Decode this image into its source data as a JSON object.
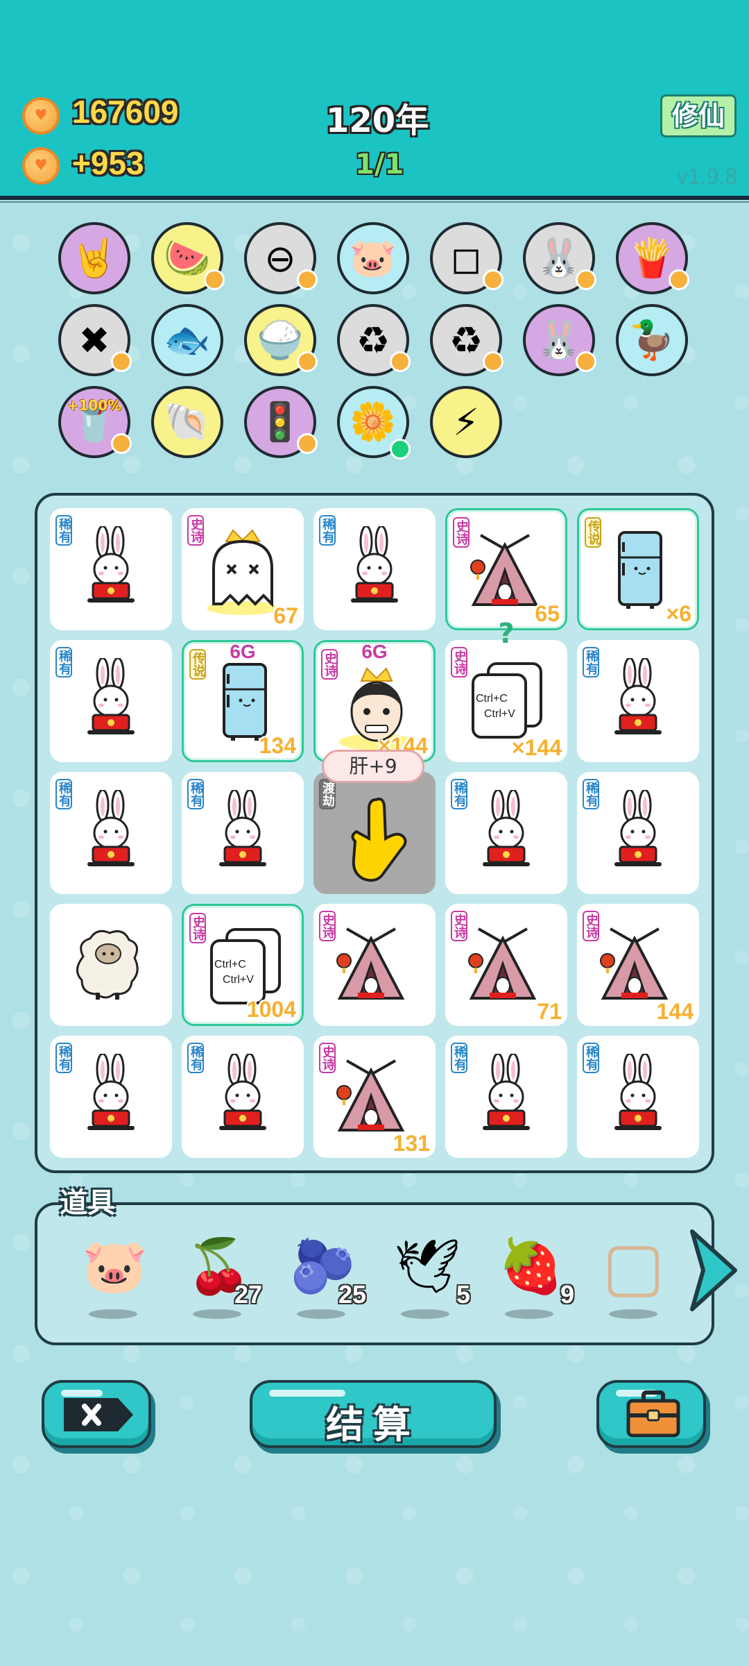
{
  "header": {
    "coins": "167609",
    "income": "+953",
    "year": "120年",
    "round": "1/1",
    "mode_button": "修仙",
    "version": "v1.9.8"
  },
  "relics": [
    {
      "icon": "rock-hand-icon",
      "bg": "#d6a8e3"
    },
    {
      "icon": "fruit-basket-icon",
      "bg": "#f7f28a",
      "badge": "V"
    },
    {
      "icon": "remove-circle-icon",
      "bg": "#dcdcdc"
    },
    {
      "icon": "piggy-bank-icon",
      "bg": "#b6ecf4"
    },
    {
      "icon": "white-cubes-icon",
      "bg": "#dcdcdc"
    },
    {
      "icon": "bunny-icon",
      "bg": "#dcdcdc"
    },
    {
      "icon": "french-fries-icon",
      "bg": "#d6a8e3"
    },
    {
      "icon": "delete-tag-icon",
      "bg": "#dcdcdc"
    },
    {
      "icon": "fish-bowl-icon",
      "bg": "#b6ecf4"
    },
    {
      "icon": "rice-bowl-icon",
      "bg": "#f7f28a"
    },
    {
      "icon": "refresh-green-icon",
      "bg": "#dcdcdc"
    },
    {
      "icon": "refresh-green-icon-2",
      "bg": "#dcdcdc"
    },
    {
      "icon": "bunny-pink-icon",
      "bg": "#d6a8e3"
    },
    {
      "icon": "duck-pot-icon",
      "bg": "#b6ecf4"
    },
    {
      "icon": "milk-tea-icon",
      "bg": "#d6a8e3",
      "label": "+100%"
    },
    {
      "icon": "shell-icon",
      "bg": "#f7f28a"
    },
    {
      "icon": "traffic-light-ghost-icon",
      "bg": "#d6a8e3"
    },
    {
      "icon": "flower-pot-icon",
      "bg": "#b6ecf4"
    },
    {
      "icon": "lightning-icon",
      "bg": "#f7f28a"
    }
  ],
  "tags": {
    "rare": "稀有",
    "epic": "史诗",
    "legend": "传说",
    "dujie": "渡劫"
  },
  "board": [
    [
      {
        "item": "bunny",
        "tag": "rare"
      },
      {
        "item": "ghost-crown",
        "tag": "epic",
        "count": "67"
      },
      {
        "item": "bunny",
        "tag": "rare"
      },
      {
        "item": "tent",
        "tag": "epic",
        "count": "65",
        "highlight": true
      },
      {
        "item": "fridge",
        "tag": "legend",
        "count": "×6",
        "highlight": true
      }
    ],
    [
      {
        "item": "bunny",
        "tag": "rare"
      },
      {
        "item": "fridge",
        "tag": "legend",
        "count": "134",
        "top": "6G",
        "highlight": true
      },
      {
        "item": "face-crown",
        "tag": "epic",
        "count": "×144",
        "top": "6G",
        "highlight": true
      },
      {
        "item": "copy-paste",
        "tag": "epic",
        "count": "×144",
        "question": "?"
      },
      {
        "item": "bunny",
        "tag": "rare"
      }
    ],
    [
      {
        "item": "bunny",
        "tag": "rare"
      },
      {
        "item": "bunny",
        "tag": "rare"
      },
      {
        "item": "hand-pointer",
        "tag": "dujie",
        "gray": true
      },
      {
        "item": "bunny",
        "tag": "rare"
      },
      {
        "item": "bunny",
        "tag": "rare"
      }
    ],
    [
      {
        "item": "sheep"
      },
      {
        "item": "copy-paste",
        "tag": "epic",
        "count": "1004",
        "highlight": true
      },
      {
        "item": "tent",
        "tag": "epic"
      },
      {
        "item": "tent",
        "tag": "epic",
        "count": "71"
      },
      {
        "item": "tent",
        "tag": "epic",
        "count": "144"
      }
    ],
    [
      {
        "item": "bunny",
        "tag": "rare"
      },
      {
        "item": "bunny",
        "tag": "rare"
      },
      {
        "item": "tent",
        "tag": "epic",
        "count": "131"
      },
      {
        "item": "bunny",
        "tag": "rare"
      },
      {
        "item": "bunny",
        "tag": "rare"
      }
    ]
  ],
  "tooltip": "肝+9",
  "copy_text": {
    "line1": "Ctrl+C",
    "line2": "Ctrl+V"
  },
  "props": {
    "title": "道具",
    "items": [
      {
        "icon": "piggy-bank-icon",
        "count": ""
      },
      {
        "icon": "bayberry-icon",
        "count": "27"
      },
      {
        "icon": "blueberry-icon",
        "count": "25"
      },
      {
        "icon": "white-bird-icon",
        "count": "5"
      },
      {
        "icon": "strawberry-icon",
        "count": "9"
      },
      {
        "icon": "picture-frame-icon",
        "count": ""
      }
    ]
  },
  "buttons": {
    "settle": "结算"
  },
  "colors": {
    "header": "#1cc3c3",
    "accent": "#2fc7c7",
    "count": "#f6b030"
  }
}
